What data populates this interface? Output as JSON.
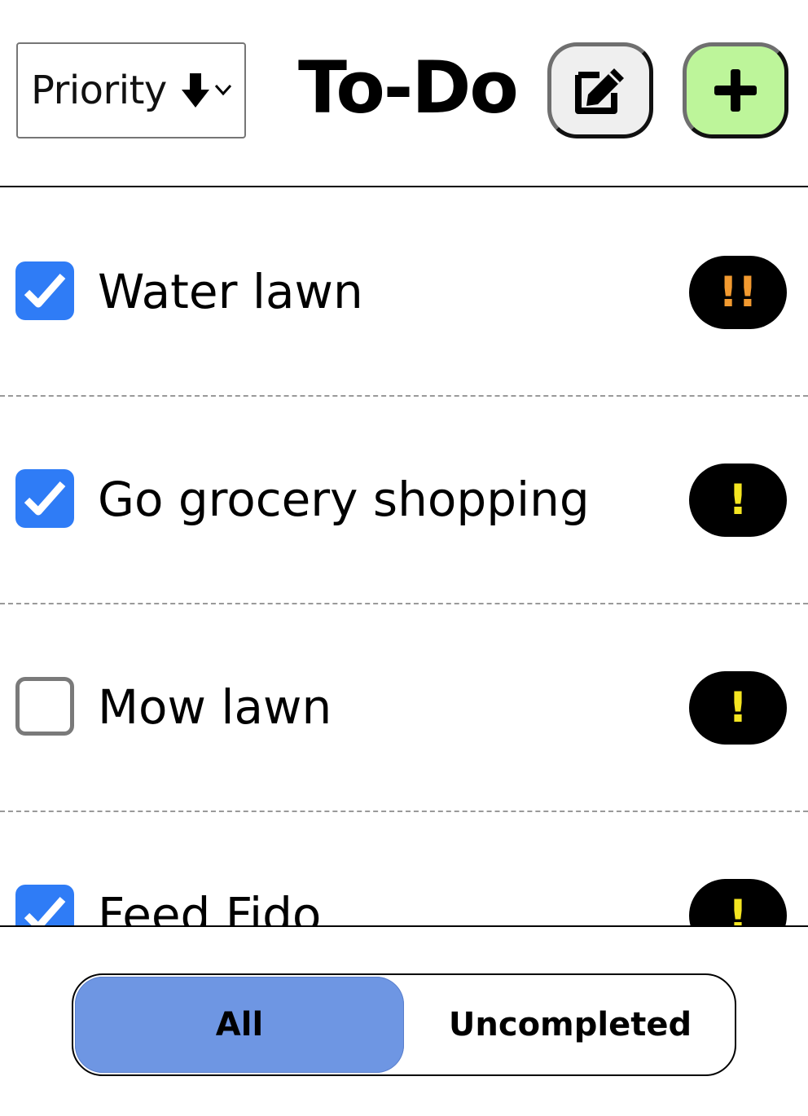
{
  "header": {
    "sort_label": "Priority",
    "sort_arrow_icon": "arrow-down-icon",
    "title": "To-Do",
    "edit_icon": "edit-icon",
    "add_icon": "plus-icon"
  },
  "tasks": [
    {
      "text": "Water lawn",
      "completed": true,
      "priority": "!!",
      "priority_color": "#f29a30"
    },
    {
      "text": "Go grocery shopping",
      "completed": true,
      "priority": "!",
      "priority_color": "#f4e521"
    },
    {
      "text": "Mow lawn",
      "completed": false,
      "priority": "!",
      "priority_color": "#f4e521"
    },
    {
      "text": "Feed Fido",
      "completed": true,
      "priority": "!",
      "priority_color": "#f4e521"
    }
  ],
  "filter": {
    "all_label": "All",
    "uncompleted_label": "Uncompleted",
    "selected": "All"
  },
  "colors": {
    "accent_blue": "#2f7cf6",
    "filter_active": "#6e96e3",
    "add_button": "#bdf59a"
  }
}
